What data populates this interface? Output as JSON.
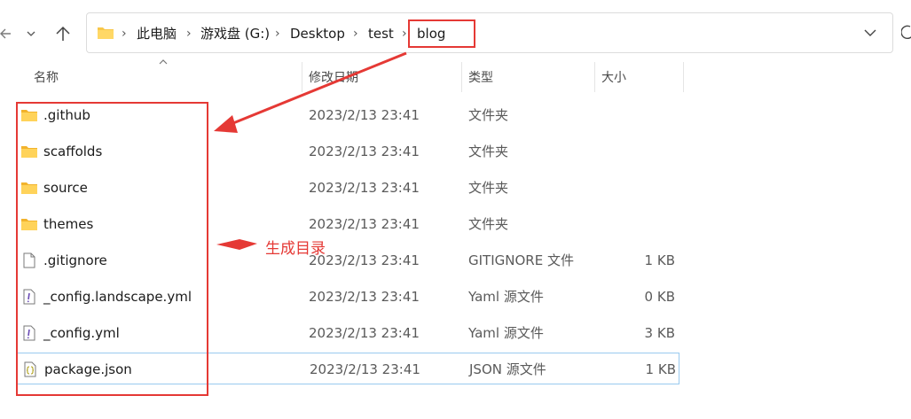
{
  "address_bar": {
    "crumbs": [
      "此电脑",
      "游戏盘 (G:)",
      "Desktop",
      "test",
      "blog"
    ]
  },
  "columns": {
    "name": "名称",
    "modified": "修改日期",
    "type": "类型",
    "size": "大小"
  },
  "files": [
    {
      "name": ".github",
      "modified": "2023/2/13 23:41",
      "type": "文件夹",
      "size": "",
      "icon": "folder-icon"
    },
    {
      "name": "scaffolds",
      "modified": "2023/2/13 23:41",
      "type": "文件夹",
      "size": "",
      "icon": "folder-icon"
    },
    {
      "name": "source",
      "modified": "2023/2/13 23:41",
      "type": "文件夹",
      "size": "",
      "icon": "folder-icon"
    },
    {
      "name": "themes",
      "modified": "2023/2/13 23:41",
      "type": "文件夹",
      "size": "",
      "icon": "folder-icon"
    },
    {
      "name": ".gitignore",
      "modified": "2023/2/13 23:41",
      "type": "GITIGNORE 文件",
      "size": "1 KB",
      "icon": "document-icon"
    },
    {
      "name": "_config.landscape.yml",
      "modified": "2023/2/13 23:41",
      "type": "Yaml 源文件",
      "size": "0 KB",
      "icon": "yaml-file-icon"
    },
    {
      "name": "_config.yml",
      "modified": "2023/2/13 23:41",
      "type": "Yaml 源文件",
      "size": "3 KB",
      "icon": "yaml-file-icon"
    },
    {
      "name": "package.json",
      "modified": "2023/2/13 23:41",
      "type": "JSON 源文件",
      "size": "1 KB",
      "icon": "json-file-icon"
    }
  ],
  "annotation": {
    "label": "生成目录",
    "color": "#e53935"
  },
  "colors": {
    "folder": "#f8c74a",
    "selection_border": "#99c9ef"
  }
}
